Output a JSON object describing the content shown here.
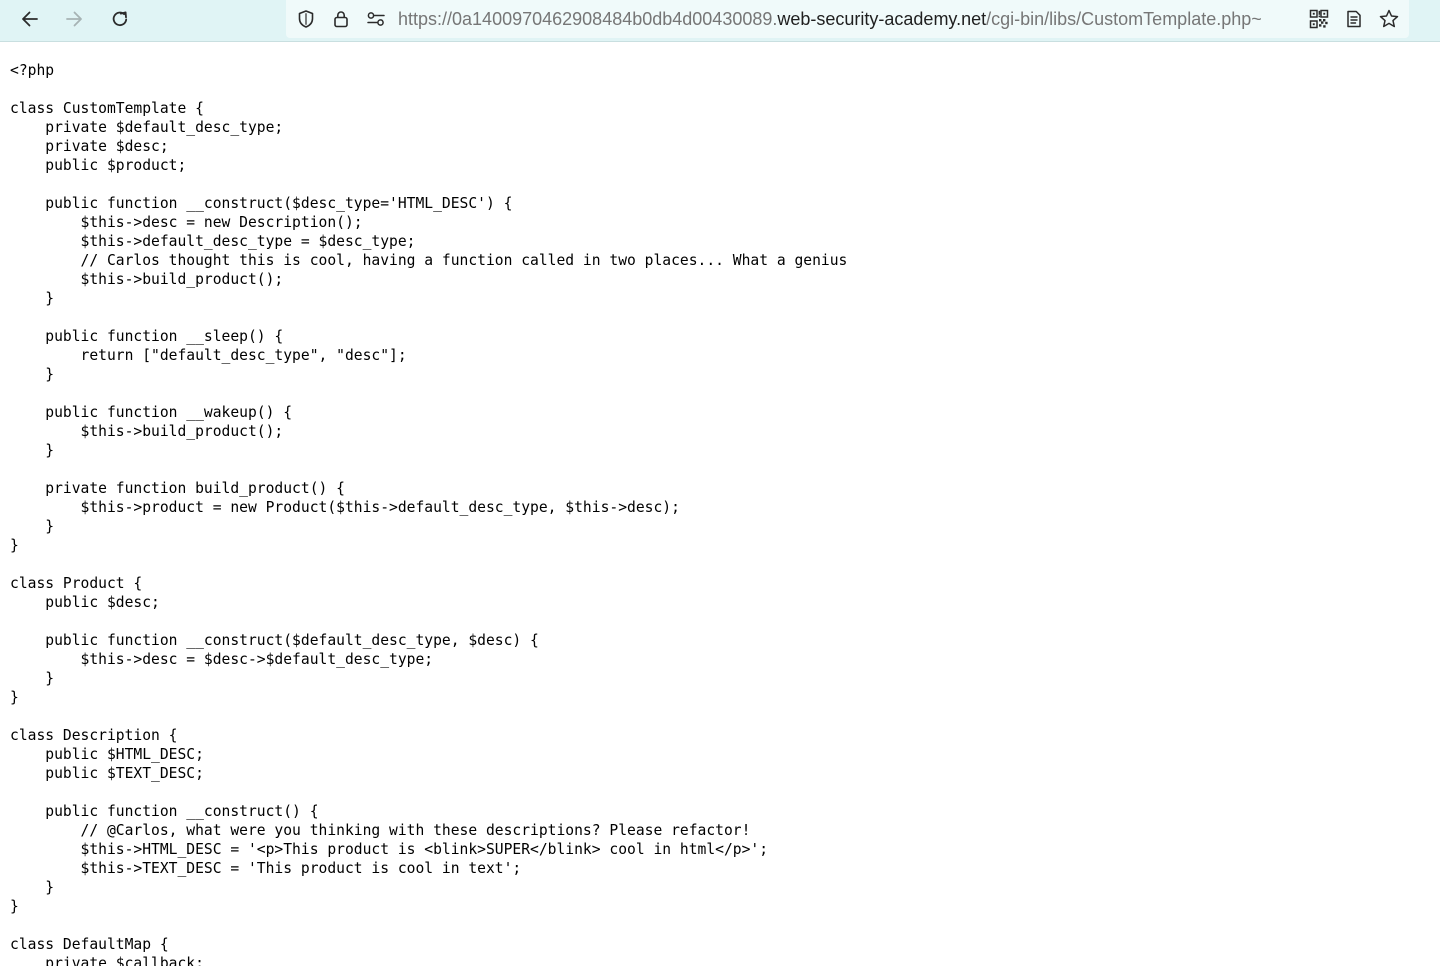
{
  "browser": {
    "url": {
      "prefix": "https://0a1400970462908484b0db4d00430089.",
      "domain": "web-security-academy.net",
      "path": "/cgi-bin/libs/CustomTemplate.php~"
    },
    "icons": {
      "back": "arrow-left-icon",
      "forward": "arrow-right-icon",
      "reload": "reload-icon",
      "tracking": "shield-icon",
      "secure": "lock-icon",
      "permissions": "permissions-sliders-icon",
      "qr": "qr-code-icon",
      "reader": "reader-view-icon",
      "bookmark": "star-icon"
    },
    "colors": {
      "toolbar": "#e0f4f5",
      "urlbar": "#f0fafa",
      "url_dim": "#767676",
      "url_domain": "#1f1f1f"
    }
  },
  "page": {
    "source": "<?php\n\nclass CustomTemplate {\n    private $default_desc_type;\n    private $desc;\n    public $product;\n\n    public function __construct($desc_type='HTML_DESC') {\n        $this->desc = new Description();\n        $this->default_desc_type = $desc_type;\n        // Carlos thought this is cool, having a function called in two places... What a genius\n        $this->build_product();\n    }\n\n    public function __sleep() {\n        return [\"default_desc_type\", \"desc\"];\n    }\n\n    public function __wakeup() {\n        $this->build_product();\n    }\n\n    private function build_product() {\n        $this->product = new Product($this->default_desc_type, $this->desc);\n    }\n}\n\nclass Product {\n    public $desc;\n\n    public function __construct($default_desc_type, $desc) {\n        $this->desc = $desc->$default_desc_type;\n    }\n}\n\nclass Description {\n    public $HTML_DESC;\n    public $TEXT_DESC;\n\n    public function __construct() {\n        // @Carlos, what were you thinking with these descriptions? Please refactor!\n        $this->HTML_DESC = '<p>This product is <blink>SUPER</blink> cool in html</p>';\n        $this->TEXT_DESC = 'This product is cool in text';\n    }\n}\n\nclass DefaultMap {\n    private $callback;"
  }
}
